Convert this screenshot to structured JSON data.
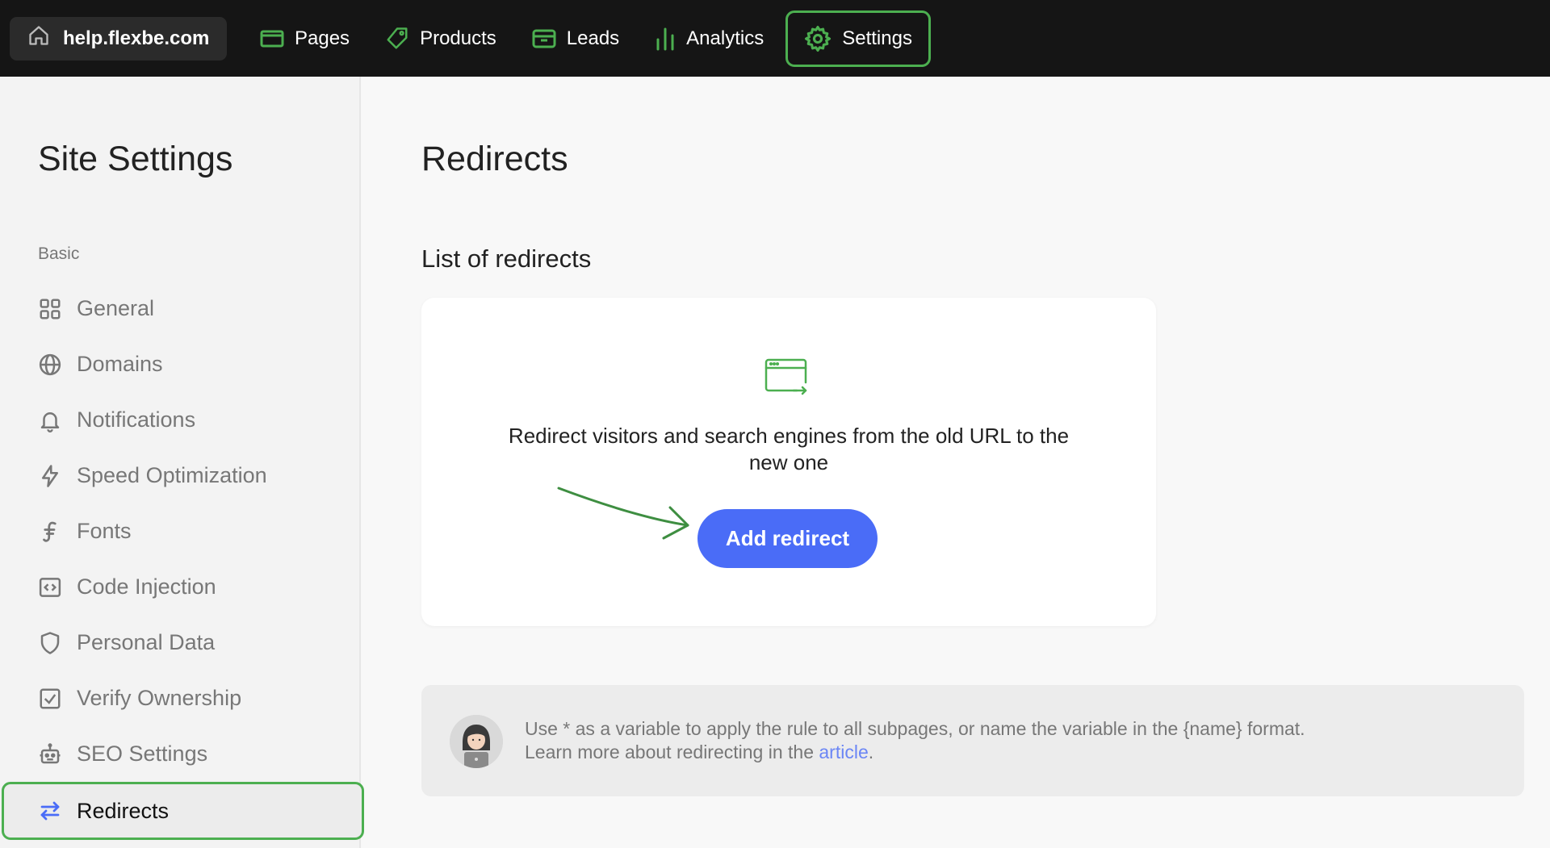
{
  "topbar": {
    "site": "help.flexbe.com",
    "nav": [
      {
        "label": "Pages",
        "icon": "pages-icon"
      },
      {
        "label": "Products",
        "icon": "tag-icon"
      },
      {
        "label": "Leads",
        "icon": "inbox-icon"
      },
      {
        "label": "Analytics",
        "icon": "bar-chart-icon"
      },
      {
        "label": "Settings",
        "icon": "gear-icon",
        "active": true
      }
    ]
  },
  "sidebar": {
    "title": "Site Settings",
    "section": "Basic",
    "items": [
      {
        "label": "General",
        "icon": "grid-icon"
      },
      {
        "label": "Domains",
        "icon": "globe-icon"
      },
      {
        "label": "Notifications",
        "icon": "bell-icon"
      },
      {
        "label": "Speed Optimization",
        "icon": "lightning-icon"
      },
      {
        "label": "Fonts",
        "icon": "font-icon"
      },
      {
        "label": "Code Injection",
        "icon": "code-icon"
      },
      {
        "label": "Personal Data",
        "icon": "shield-icon"
      },
      {
        "label": "Verify Ownership",
        "icon": "checkbox-icon"
      },
      {
        "label": "SEO Settings",
        "icon": "robot-icon"
      },
      {
        "label": "Redirects",
        "icon": "swap-arrows-icon",
        "active": true
      }
    ]
  },
  "main": {
    "title": "Redirects",
    "section_title": "List of redirects",
    "card": {
      "text": "Redirect visitors and search engines from the old URL to the new one",
      "button": "Add redirect"
    },
    "hint": {
      "line1": "Use * as a variable to apply the rule to all subpages, or name the variable in the {name} format.",
      "line2_prefix": "Learn more about redirecting in the ",
      "link": "article",
      "line2_suffix": "."
    }
  },
  "colors": {
    "accent_green": "#4caf50",
    "button_blue": "#4a6cf7",
    "link_blue": "#6b86f5",
    "topbar_bg": "#151515"
  }
}
